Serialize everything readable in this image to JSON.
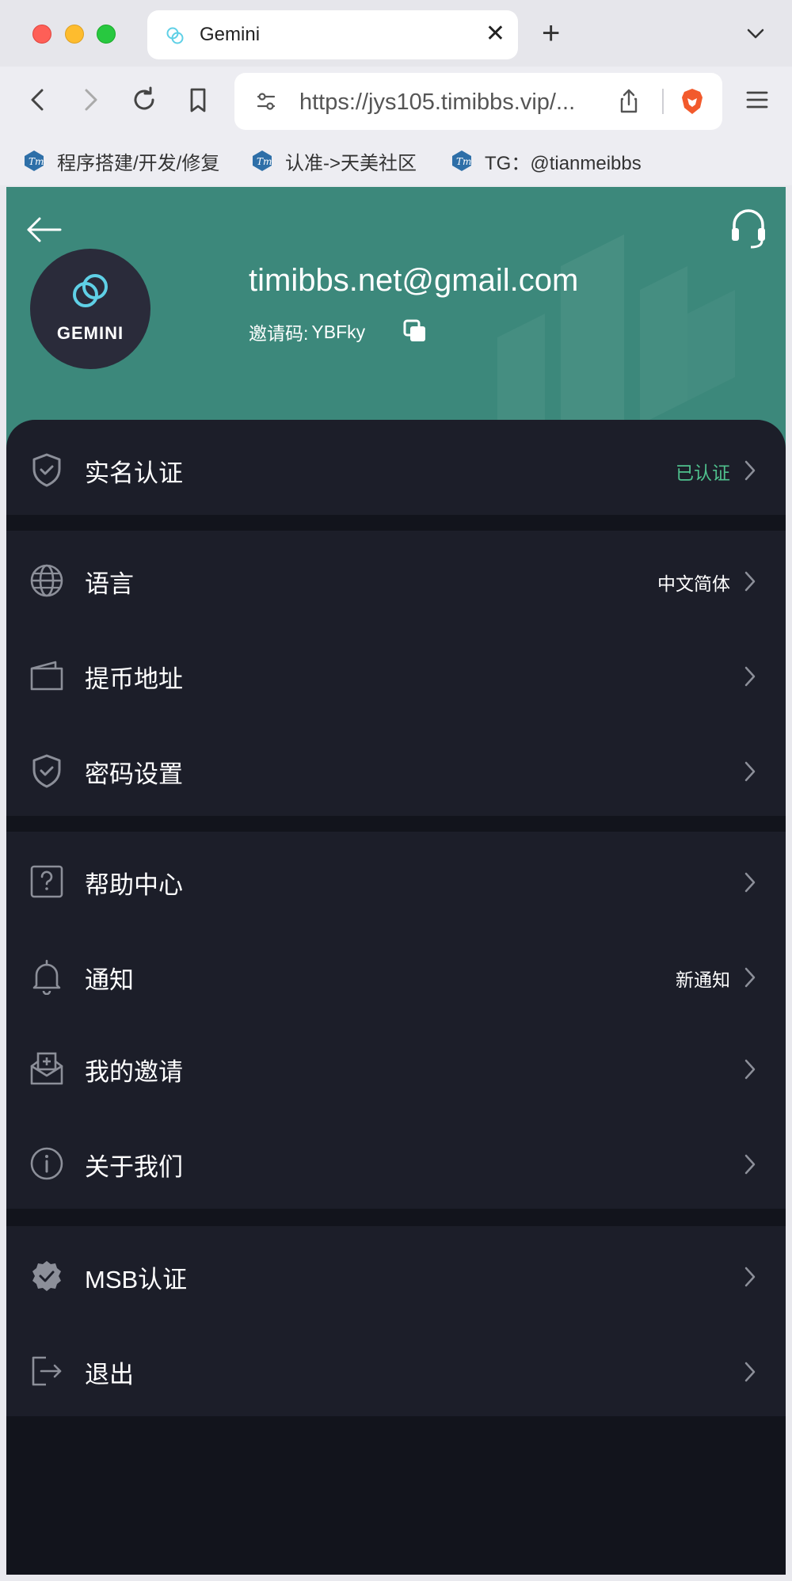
{
  "browser": {
    "tab_title": "Gemini",
    "tab_close": "✕",
    "new_tab": "+",
    "url": "https://jys105.timibbs.vip/...",
    "bookmarks": [
      {
        "label": "程序搭建/开发/修复"
      },
      {
        "label": "认准->天美社区"
      },
      {
        "label": "TG：@tianmeibbs"
      }
    ]
  },
  "profile": {
    "avatar_text": "GEMINI",
    "email": "timibbs.net@gmail.com",
    "invite_label": "邀请码:",
    "invite_code": "YBFky"
  },
  "menu": {
    "verification": {
      "label": "实名认证",
      "value": "已认证"
    },
    "language": {
      "label": "语言",
      "value": "中文简体"
    },
    "withdraw_address": {
      "label": "提币地址"
    },
    "password": {
      "label": "密码设置"
    },
    "help": {
      "label": "帮助中心"
    },
    "notifications": {
      "label": "通知",
      "value": "新通知"
    },
    "invitations": {
      "label": "我的邀请"
    },
    "about": {
      "label": "关于我们"
    },
    "msb": {
      "label": "MSB认证"
    },
    "logout": {
      "label": "退出"
    }
  },
  "colors": {
    "header_bg": "#3c887b",
    "page_bg": "#12141c",
    "card_bg": "#1c1e29",
    "verified_green": "#4fc08d",
    "icon_gray": "#8c8f99"
  }
}
